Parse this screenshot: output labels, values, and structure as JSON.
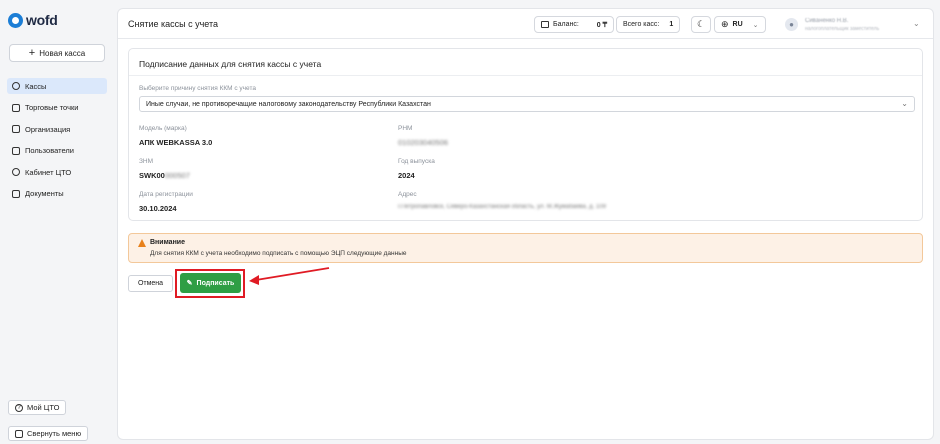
{
  "app": {
    "brand": "wofd"
  },
  "sidebar": {
    "new_button": "Новая касса",
    "items": [
      {
        "label": "Кассы",
        "icon": "cash-register-icon",
        "active": true
      },
      {
        "label": "Торговые точки",
        "icon": "store-icon",
        "active": false
      },
      {
        "label": "Организация",
        "icon": "briefcase-icon",
        "active": false
      },
      {
        "label": "Пользователи",
        "icon": "users-icon",
        "active": false
      },
      {
        "label": "Кабинет ЦТО",
        "icon": "service-center-icon",
        "active": false
      },
      {
        "label": "Документы",
        "icon": "document-icon",
        "active": false
      }
    ],
    "my_cto": "Мой ЦТО",
    "collapse": "Свернуть меню"
  },
  "header": {
    "title": "Снятие кассы с учета",
    "balance_label": "Баланс:",
    "balance_value": "0 ₸",
    "total_label": "Всего касс:",
    "total_value": "1",
    "language": "RU",
    "user_name": "Сиваненко Н.В.",
    "user_role": "налогоплательщик заместитель"
  },
  "form": {
    "title": "Подписание данных для снятия кассы с учета",
    "reason_label": "Выберите причину снятия ККМ с учета",
    "reason_value": "Иные случаи, не противоречащие налоговому законодательству Республики Казахстан",
    "model_label": "Модель (марка)",
    "model_value": "АПК WEBKASSA 3.0",
    "rnm_label": "РНМ",
    "rnm_value": "010203040506",
    "znm_label": "ЗНМ",
    "znm_value_prefix": "SWK00",
    "znm_value_hidden": "000507",
    "year_label": "Год выпуска",
    "year_value": "2024",
    "reg_date_label": "Дата регистрации",
    "reg_date_value": "30.10.2024",
    "address_label": "Адрес",
    "address_value": "г.Петропавловск, Северо-Казахстанская область, ул. М.Жумабаева, д. 109"
  },
  "warning": {
    "title": "Внимание",
    "text": "Для снятия ККМ с учета необходимо подписать с помощью ЭЦП следующие данные"
  },
  "actions": {
    "cancel": "Отмена",
    "sign": "Подписать"
  },
  "colors": {
    "accent": "#2f9e44",
    "highlight": "#e01b24",
    "warning": "#e8811c"
  }
}
